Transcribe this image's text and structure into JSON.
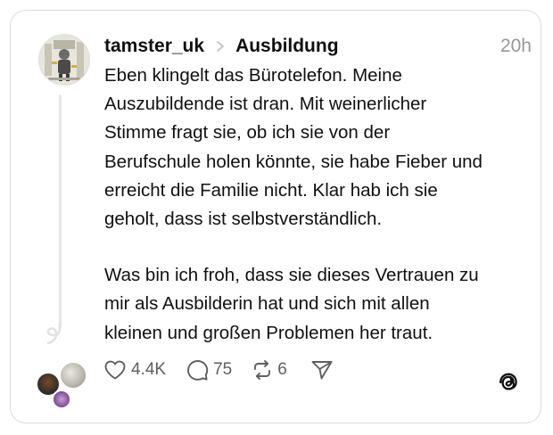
{
  "post": {
    "username": "tamster_uk",
    "topic": "Ausbildung",
    "time": "20h",
    "paragraph1_lines": [
      "Eben klingelt das Bürotelefon. Meine",
      "Auszubildende ist dran. Mit weinerlicher",
      "Stimme fragt sie, ob ich sie von der",
      "Berufschule holen könnte, sie habe Fieber und",
      "erreicht die Familie nicht. Klar hab ich sie",
      "geholt, dass ist selbstverständlich."
    ],
    "paragraph2_lines": [
      "Was bin ich froh, dass sie dieses Vertrauen zu",
      "mir als Ausbilderin hat und sich mit allen",
      "kleinen und großen Problemen her traut."
    ]
  },
  "actions": {
    "like_count": "4.4K",
    "reply_count": "75",
    "repost_count": "6"
  },
  "icons": {
    "like": "heart-icon",
    "reply": "comment-icon",
    "repost": "repost-icon",
    "share": "send-icon",
    "chevron": "chevron-right-icon",
    "brand": "threads-logo-icon"
  },
  "colors": {
    "text": "#101010",
    "muted": "#999999",
    "action": "#5f5f5f",
    "border": "#dcdcdc"
  }
}
